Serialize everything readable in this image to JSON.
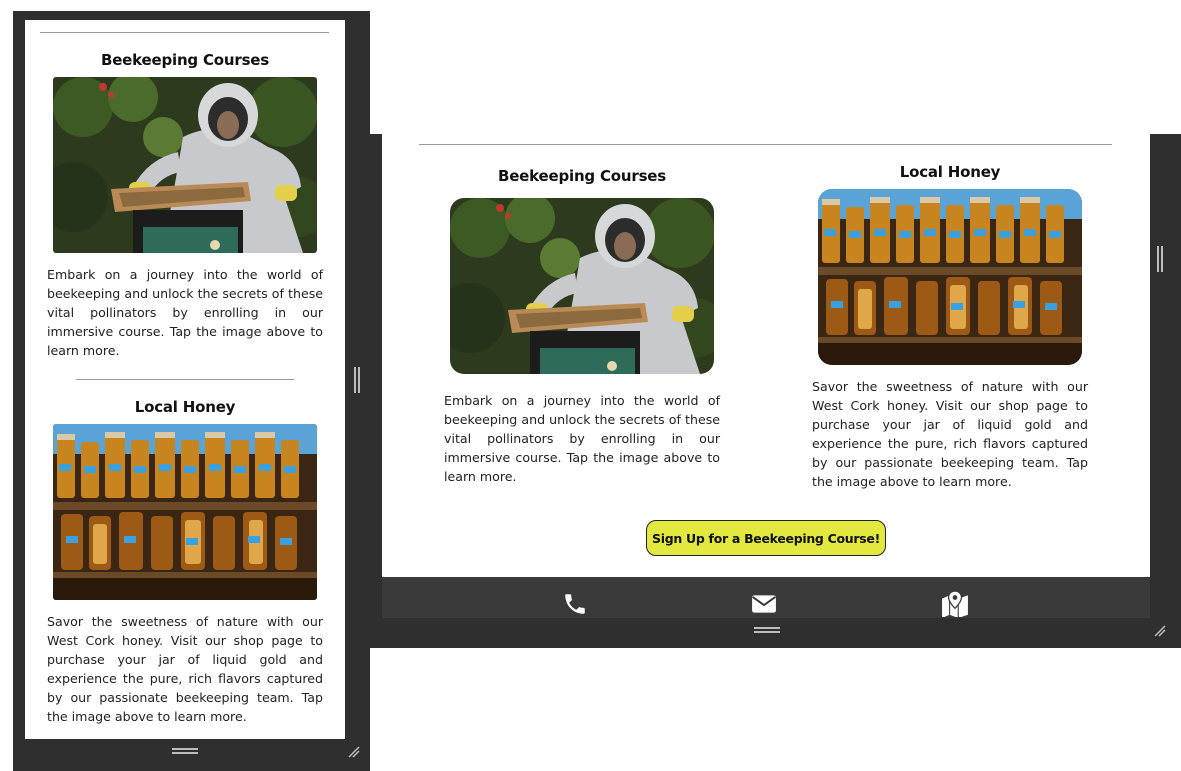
{
  "mobile": {
    "card1": {
      "title": "Beekeeping Courses",
      "text": "Embark on a journey into the world of beekeeping and unlock the secrets of these vital pollinators by enrolling in our immersive course. Tap the image above to learn more."
    },
    "card2": {
      "title": "Local Honey",
      "text": "Savor the sweetness of nature with our West Cork honey. Visit our shop page to purchase your jar of liquid gold and experience the pure, rich flavors captured by our passionate beekeeping team. Tap the image above to learn more."
    }
  },
  "tablet": {
    "card1": {
      "title": "Beekeeping Courses",
      "text": "Embark on a journey into the world of beekeeping and unlock the secrets of these vital pollinators by enrolling in our immersive course. Tap the image above to learn more."
    },
    "card2": {
      "title": "Local Honey",
      "text": "Savor the sweetness of nature with our West Cork honey. Visit our shop page to purchase your jar of liquid gold and experience the pure, rich flavors captured by our passionate beekeeping team. Tap the image above to learn more."
    },
    "cta_label": "Sign Up for a Beekeeping Course!",
    "footer_icons": [
      "phone-icon",
      "envelope-icon",
      "map-icon"
    ]
  },
  "colors": {
    "frame": "#2f2f2f",
    "footer": "#3a3a3a",
    "cta": "#e3e83f"
  }
}
